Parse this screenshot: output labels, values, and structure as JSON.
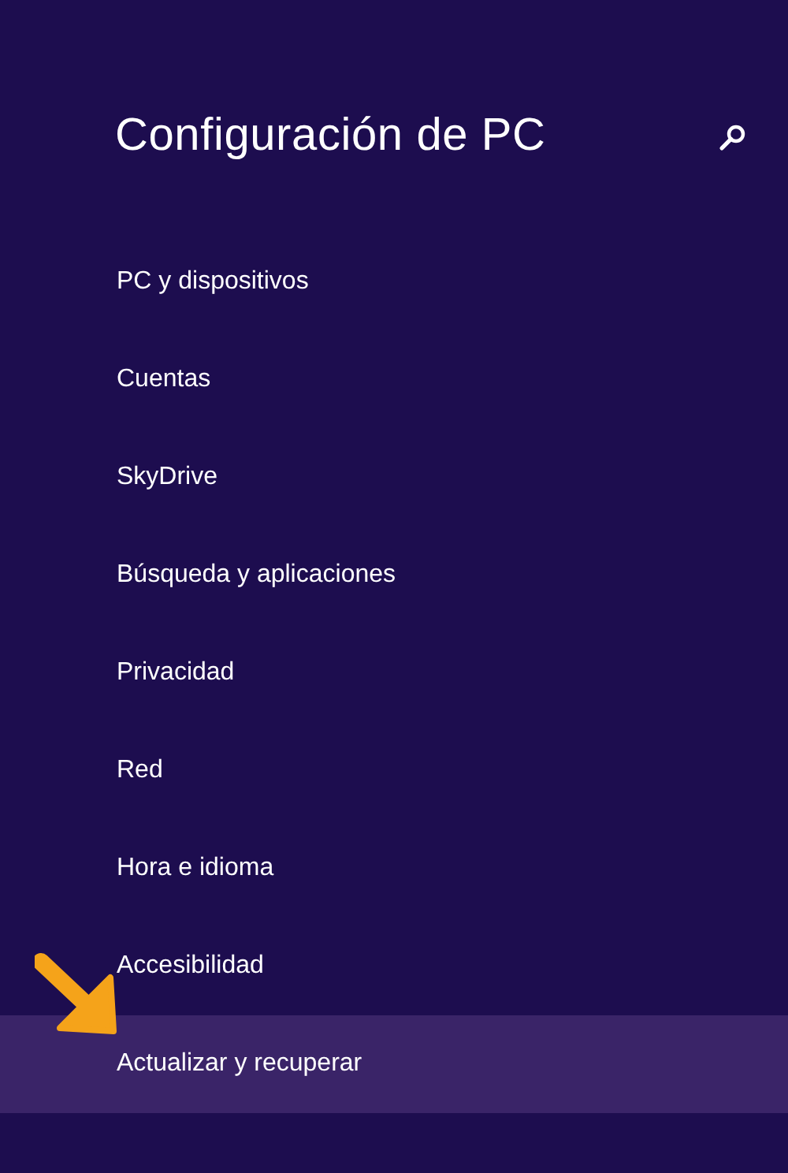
{
  "header": {
    "title": "Configuración de PC"
  },
  "items": [
    {
      "label": "PC y dispositivos",
      "selected": false
    },
    {
      "label": "Cuentas",
      "selected": false
    },
    {
      "label": "SkyDrive",
      "selected": false
    },
    {
      "label": "Búsqueda y aplicaciones",
      "selected": false
    },
    {
      "label": "Privacidad",
      "selected": false
    },
    {
      "label": "Red",
      "selected": false
    },
    {
      "label": "Hora e idioma",
      "selected": false
    },
    {
      "label": "Accesibilidad",
      "selected": false
    },
    {
      "label": "Actualizar y recuperar",
      "selected": true
    }
  ]
}
